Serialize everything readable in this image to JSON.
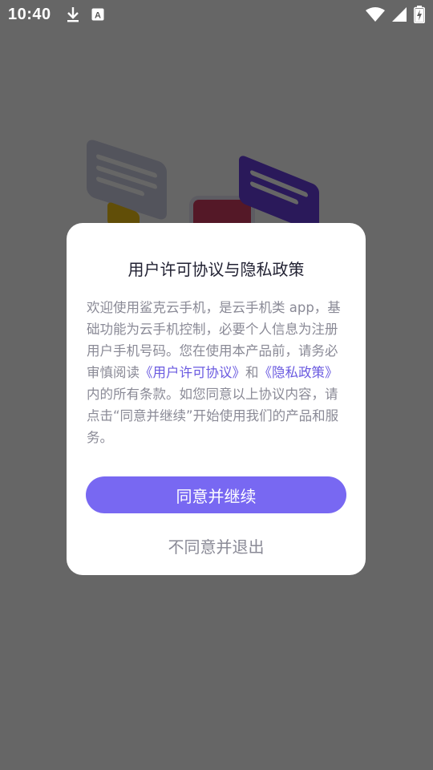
{
  "status_bar": {
    "time": "10:40",
    "icons": [
      "download-icon",
      "a-badge-icon",
      "wifi-icon",
      "signal-icon",
      "battery-charging-icon"
    ]
  },
  "dialog": {
    "title": "用户许可协议与隐私政策",
    "body": {
      "text_1": "欢迎使用鲨克云手机，是云手机类 app，基础功能为云手机控制，必要个人信息为注册用户手机号码。您在使用本产品前，请务必审慎阅读",
      "link_user_agreement": "《用户许可协议》",
      "text_2": "和",
      "link_privacy_policy": "《隐私政策》",
      "text_3": "内的所有条款。如您同意以上协议内容，请点击“同意并继续”开始使用我们的产品和服务。"
    },
    "agree_label": "同意并继续",
    "disagree_label": "不同意并退出"
  },
  "colors": {
    "accent": "#7868f2",
    "link": "#6a5ae0",
    "overlay": "rgba(0,0,0,0.6)"
  }
}
